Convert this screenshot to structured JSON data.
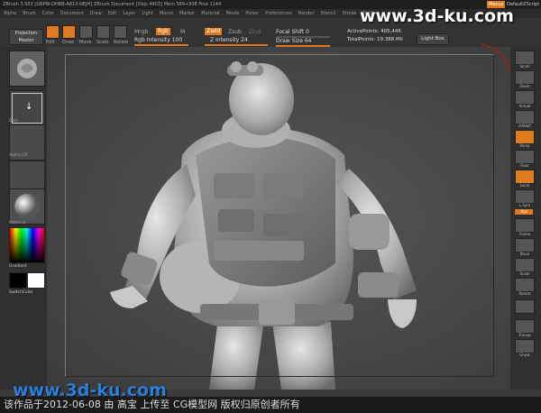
{
  "titlebar": {
    "text": "ZBrush 3.502 [GBPW-DHBB-A813-NEJH]   ZBrush Document   [Objs 4903] Mem 589+508 Free 1144"
  },
  "top_right": {
    "menus_label": "Menus",
    "script_label": "DefaultZScript"
  },
  "menubar": {
    "items": [
      "Alpha",
      "Brush",
      "Color",
      "Document",
      "Draw",
      "Edit",
      "Layer",
      "Light",
      "Macro",
      "Marker",
      "Material",
      "Movie",
      "Picker",
      "Preferences",
      "Render",
      "Stencil",
      "Stroke",
      "Texture"
    ]
  },
  "toolbar": {
    "projection_master": "Projection Master",
    "buttons": [
      "Edit",
      "Draw",
      "Move",
      "Scale",
      "Rotate"
    ],
    "mrgb": "Mrgb",
    "rgb": "Rgb",
    "m": "M",
    "rgb_intensity_label": "Rgb Intensity",
    "rgb_intensity_value": "100",
    "zadd": "Zadd",
    "zsub": "Zsub",
    "zcut": "Zcut",
    "z_intensity_label": "Z Intensity",
    "z_intensity_value": "24",
    "focal_shift_label": "Focal Shift",
    "focal_shift_value": "0",
    "draw_size_label": "Draw Size",
    "draw_size_value": "64",
    "active_points_label": "ActivePoints:",
    "active_points_value": "405,446",
    "total_points_label": "TotalPoints:",
    "total_points_value": "19.388 Mil",
    "light_box": "Light Box"
  },
  "left_shelf": {
    "captions": [
      "",
      "Dots",
      "Alpha Off",
      "Texture Off",
      "Material",
      "Gradient",
      "SwitchColor"
    ]
  },
  "right_shelf": {
    "items": [
      "Scroll",
      "Zoom",
      "Actual",
      "AAHalf",
      "Persp",
      "Floor",
      "Local",
      "L.Sym",
      "Xyz",
      "Frame",
      "Move",
      "Scale",
      "Rotate",
      "",
      "Transp",
      "Ghost"
    ]
  },
  "watermark": {
    "top": "www.3d-ku.com",
    "bottom": "www.3d-ku.com"
  },
  "footer": {
    "text": "该作品于2012-06-08 由 高宝 上传至 CG模型网   版权归原创者所有"
  },
  "colors": {
    "accent": "#e07a20",
    "background": "#3a3a3a",
    "watermark_blue": "#2b7fd8"
  }
}
